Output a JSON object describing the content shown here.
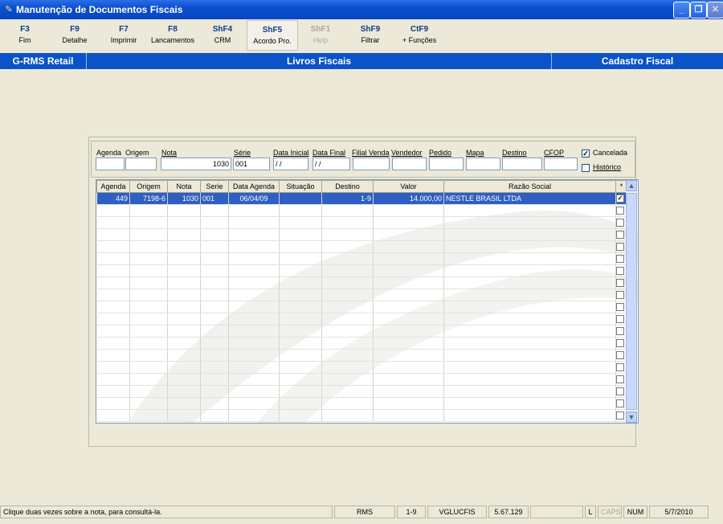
{
  "window": {
    "title": "Manutenção de Documentos Fiscais"
  },
  "toolbar": [
    {
      "key": "F3",
      "label": "Fim"
    },
    {
      "key": "F9",
      "label": "Detalhe"
    },
    {
      "key": "F7",
      "label": "Imprimir"
    },
    {
      "key": "F8",
      "label": "Lancamentos"
    },
    {
      "key": "ShF4",
      "label": "CRM"
    },
    {
      "key": "ShF5",
      "label": "Acordo Pro."
    },
    {
      "key": "ShF1",
      "label": "Help"
    },
    {
      "key": "ShF9",
      "label": "Filtrar"
    },
    {
      "key": "CtF9",
      "label": "+ Funções"
    }
  ],
  "banner": {
    "left": "G-RMS Retail",
    "center": "Livros Fiscais",
    "right": "Cadastro Fiscal"
  },
  "filters": {
    "agenda_label": "Agenda",
    "agenda_value": "",
    "origem_label": "Origem",
    "origem_value": "",
    "nota_label": "Nota",
    "nota_value": "1030",
    "serie_label": "Série",
    "serie_value": "001",
    "data_inicial_label": "Data Inicial",
    "data_inicial_value": " / /",
    "data_final_label": "Data Final",
    "data_final_value": " / /",
    "filial_venda_label": "Filial Venda",
    "filial_venda_value": "",
    "vendedor_label": "Vendedor",
    "vendedor_value": "",
    "pedido_label": "Pedido",
    "pedido_value": "",
    "mapa_label": "Mapa",
    "mapa_value": "",
    "destino_label": "Destino",
    "destino_value": "",
    "cfop_label": "CFOP",
    "cfop_value": "",
    "cancelada_label": "Cancelada",
    "cancelada_checked": true,
    "historico_label": "Histórico",
    "historico_checked": false
  },
  "grid": {
    "headers": [
      "Agenda",
      "Origem",
      "Nota",
      "Serie",
      "Data Agenda",
      "Situação",
      "Destino",
      "Valor",
      "Razão Social",
      "*"
    ],
    "rows": [
      [
        "449",
        "7198-6",
        "1030",
        "001",
        "06/04/09",
        "",
        "1-9",
        "14.000,00",
        "NESTLE BRASIL LTDA",
        true
      ]
    ],
    "scroll_up_icon": "▲",
    "scroll_down_icon": "▼"
  },
  "status": {
    "message": "Clique duas vezes sobre a nota, para consultá-la.",
    "system": "RMS",
    "branch": "1-9",
    "user": "VGLUCFIS",
    "version": "5.67.129",
    "extra": "",
    "l": "L",
    "caps": "CAPS",
    "num": "NUM",
    "date": "5/7/2010"
  }
}
